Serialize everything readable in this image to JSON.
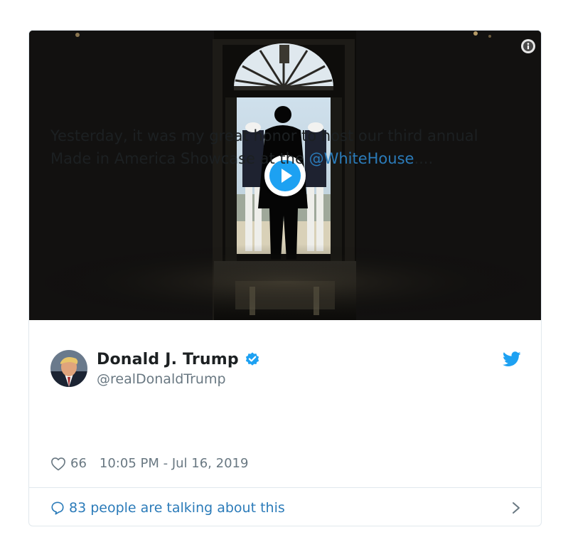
{
  "tweet": {
    "author": {
      "display_name": "Donald J. Trump",
      "screen_name": "@realDonaldTrump",
      "verified": true
    },
    "text_before": "Yesterday, it was my great honor to host our third annual Made in America Showcase at the ",
    "mention": "@WhiteHouse",
    "text_after": "....",
    "likes": "66",
    "timestamp": "10:05 PM - Jul 16, 2019",
    "talking_about": "83 people are talking about this"
  },
  "icons": {
    "info": "info-icon",
    "play": "play-icon",
    "verified": "verified-badge-icon",
    "bird": "twitter-bird-icon",
    "heart": "heart-icon",
    "reply": "reply-bubble-icon",
    "chevron": "chevron-right-icon"
  },
  "colors": {
    "brand_blue": "#1da1f2",
    "link_blue": "#2b7bb9",
    "muted_text": "#697882",
    "border": "#e1e8ed"
  }
}
